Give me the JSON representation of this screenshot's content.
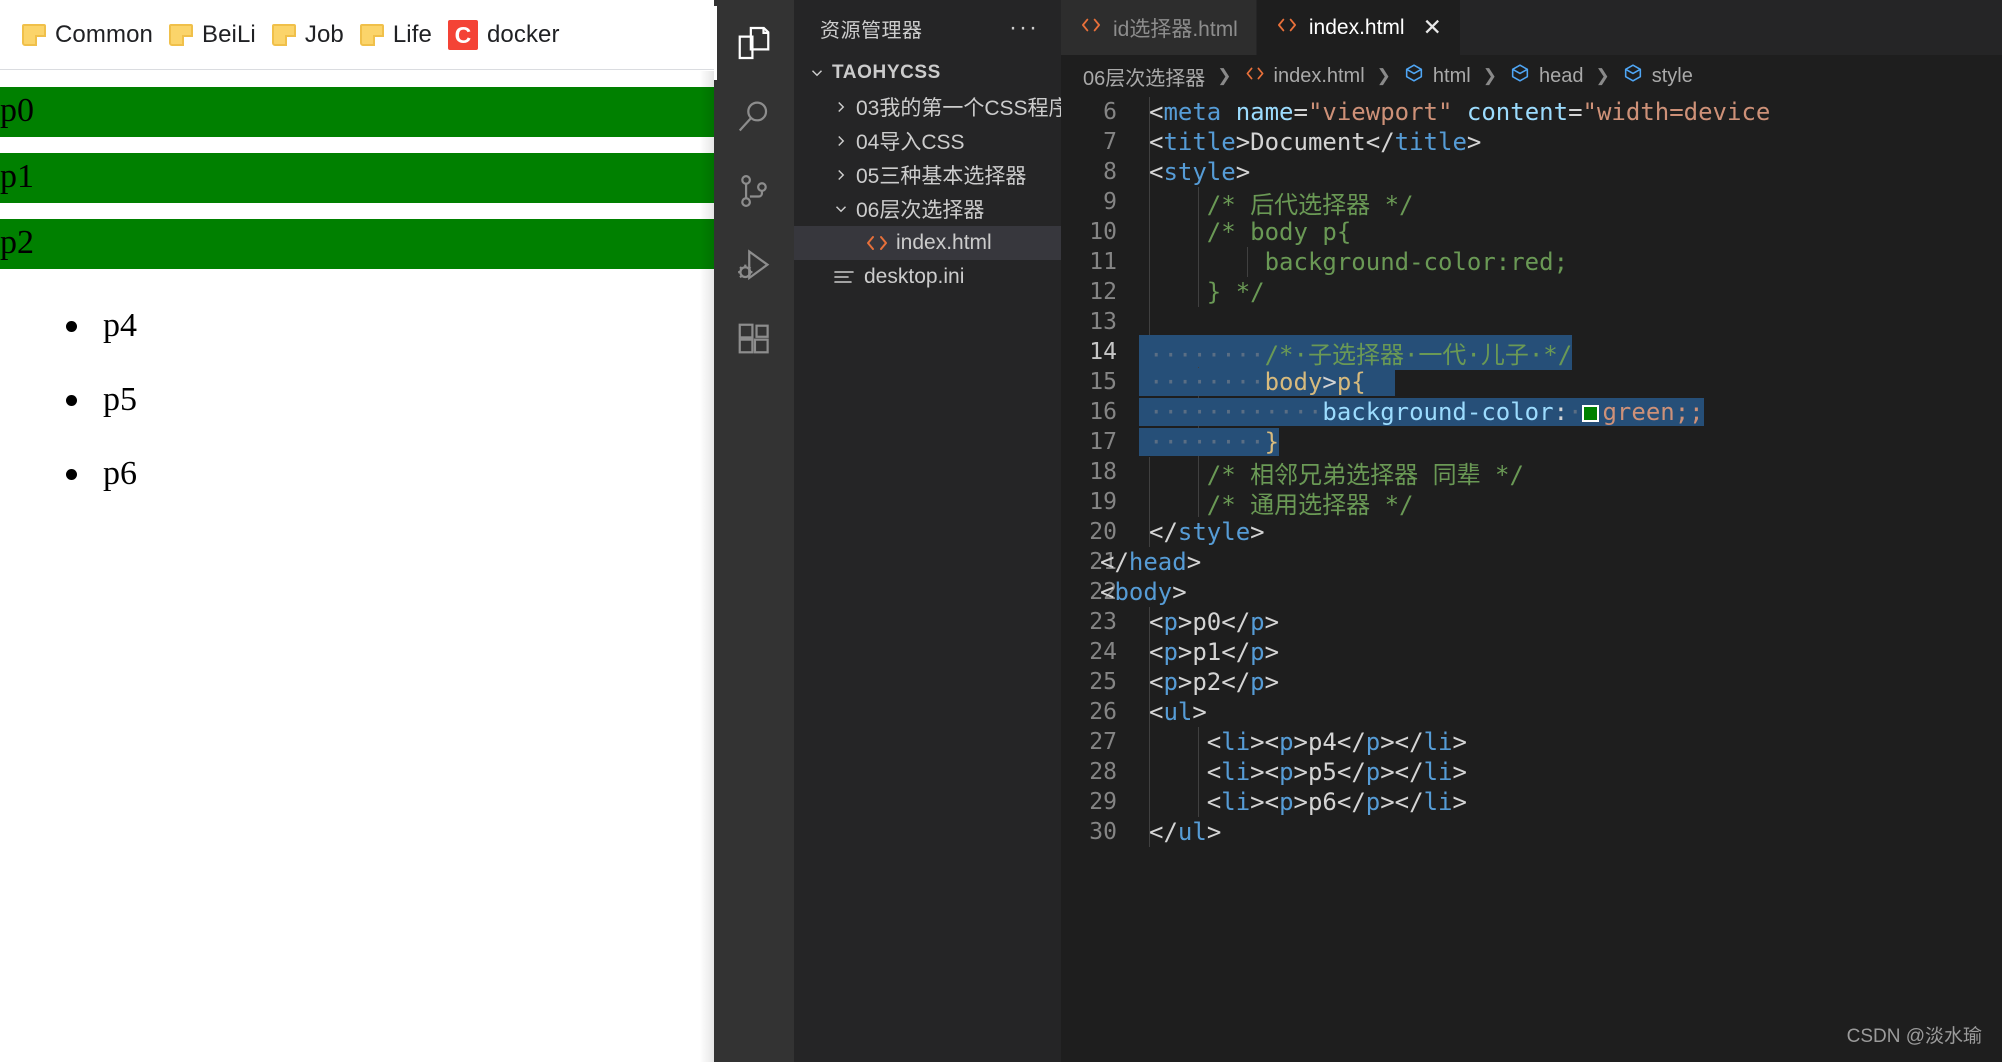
{
  "browser": {
    "bookmarks": [
      {
        "label": "Common",
        "icon": "folder-icon"
      },
      {
        "label": "BeiLi",
        "icon": "folder-icon"
      },
      {
        "label": "Job",
        "icon": "folder-icon"
      },
      {
        "label": "Life",
        "icon": "folder-icon"
      },
      {
        "label": "docker",
        "icon": "csdn-c-icon"
      }
    ],
    "page": {
      "paragraphs": [
        "p0",
        "p1",
        "p2"
      ],
      "list_items": [
        "p4",
        "p5",
        "p6"
      ],
      "paragraph_bg": "#008000"
    }
  },
  "vscode": {
    "activity_bar": [
      {
        "name": "explorer-icon",
        "active": true
      },
      {
        "name": "search-icon",
        "active": false
      },
      {
        "name": "source-control-icon",
        "active": false
      },
      {
        "name": "run-and-debug-icon",
        "active": false
      },
      {
        "name": "extensions-icon",
        "active": false
      }
    ],
    "sidebar": {
      "title": "资源管理器",
      "more_actions": "···",
      "root": "TAOHYCSS",
      "tree": [
        {
          "label": "03我的第一个CSS程序",
          "type": "folder",
          "expanded": false
        },
        {
          "label": "04导入CSS",
          "type": "folder",
          "expanded": false
        },
        {
          "label": "05三种基本选择器",
          "type": "folder",
          "expanded": false
        },
        {
          "label": "06层次选择器",
          "type": "folder",
          "expanded": true
        },
        {
          "label": "index.html",
          "type": "html",
          "selected": true
        },
        {
          "label": "desktop.ini",
          "type": "ini",
          "selected": false
        }
      ]
    },
    "tabs": [
      {
        "label": "id选择器.html",
        "active": false,
        "closable": false
      },
      {
        "label": "index.html",
        "active": true,
        "closable": true,
        "close": "✕"
      }
    ],
    "breadcrumb": [
      {
        "label": "06层次选择器",
        "icon": "none"
      },
      {
        "label": "index.html",
        "icon": "html-icon"
      },
      {
        "label": "html",
        "icon": "symbol-field-icon"
      },
      {
        "label": "head",
        "icon": "symbol-field-icon"
      },
      {
        "label": "style",
        "icon": "symbol-field-icon"
      }
    ],
    "breadcrumb_separator": "❯",
    "watermark": "CSDN @淡水瑜",
    "code": {
      "first_line_number": 6,
      "lines": [
        {
          "n": 6,
          "selected": false,
          "indent": 1
        },
        {
          "n": 7,
          "selected": false,
          "indent": 1
        },
        {
          "n": 8,
          "selected": false,
          "indent": 1
        },
        {
          "n": 9,
          "selected": false,
          "indent": 2
        },
        {
          "n": 10,
          "selected": false,
          "indent": 2
        },
        {
          "n": 11,
          "selected": false,
          "indent": 3
        },
        {
          "n": 12,
          "selected": false,
          "indent": 2
        },
        {
          "n": 13,
          "selected": false,
          "indent": 0
        },
        {
          "n": 14,
          "selected": true,
          "indent": 2
        },
        {
          "n": 15,
          "selected": true,
          "indent": 2
        },
        {
          "n": 16,
          "selected": true,
          "indent": 3
        },
        {
          "n": 17,
          "selected": true,
          "indent": 2
        },
        {
          "n": 18,
          "selected": false,
          "indent": 2
        },
        {
          "n": 19,
          "selected": false,
          "indent": 2
        },
        {
          "n": 20,
          "selected": false,
          "indent": 1
        },
        {
          "n": 21,
          "selected": false,
          "indent": 0
        },
        {
          "n": 22,
          "selected": false,
          "indent": 0
        },
        {
          "n": 23,
          "selected": false,
          "indent": 1
        },
        {
          "n": 24,
          "selected": false,
          "indent": 1
        },
        {
          "n": 25,
          "selected": false,
          "indent": 1
        },
        {
          "n": 26,
          "selected": false,
          "indent": 1
        },
        {
          "n": 27,
          "selected": false,
          "indent": 2
        },
        {
          "n": 28,
          "selected": false,
          "indent": 2
        },
        {
          "n": 29,
          "selected": false,
          "indent": 2
        },
        {
          "n": 30,
          "selected": false,
          "indent": 1
        }
      ],
      "text": {
        "l6": "    <meta name=\"viewport\" content=\"width=device",
        "l7": "    <title>Document</title>",
        "l8": "    <style>",
        "l9": "        /* 后代选择器 */",
        "l10": "        /* body p{",
        "l11": "            background-color:red;",
        "l12": "        } */",
        "l13": "",
        "l14": "        /* 子选择器 一代 儿子 */",
        "l15": "        body>p{",
        "l16": "            background-color: green;;",
        "l17": "        }",
        "l18": "        /* 相邻兄弟选择器 同辈 */",
        "l19": "        /* 通用选择器 */",
        "l20": "    </style>",
        "l21": "</head>",
        "l22": "<body>",
        "l23": "    <p>p0</p>",
        "l24": "    <p>p1</p>",
        "l25": "    <p>p2</p>",
        "l26": "    <ul>",
        "l27": "        <li><p>p4</p></li>",
        "l28": "        <li><p>p5</p></li>",
        "l29": "        <li><p>p6</p></li>",
        "l30": "    </ul>"
      }
    }
  }
}
